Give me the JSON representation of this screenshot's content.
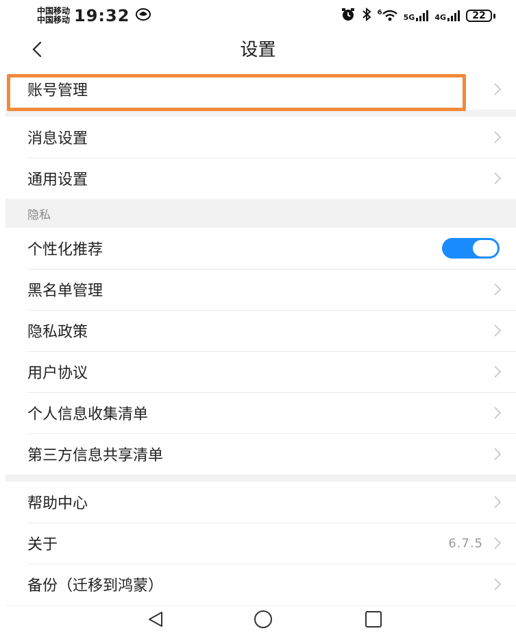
{
  "status_bar": {
    "carrier_1": "中国移动",
    "carrier_2": "中国移动",
    "time": "19:32",
    "net_5g": "5G",
    "net_4g": "4G",
    "wifi_badge": "6",
    "battery": "22"
  },
  "header": {
    "title": "设置"
  },
  "sections": {
    "account": {
      "items": [
        "账号管理"
      ]
    },
    "general": {
      "items": [
        "消息设置",
        "通用设置"
      ]
    },
    "privacy": {
      "header": "隐私",
      "toggle_label": "个性化推荐",
      "toggle_on": true,
      "items": [
        "黑名单管理",
        "隐私政策",
        "用户协议",
        "个人信息收集清单",
        "第三方信息共享清单"
      ]
    },
    "help": {
      "help_center": "帮助中心",
      "about": "关于",
      "about_version": "6.7.5",
      "backup": "备份（迁移到鸿蒙）"
    }
  },
  "colors": {
    "accent": "#1a8cff",
    "highlight": "#f08a3c",
    "section_bg": "#f2f2f2"
  }
}
